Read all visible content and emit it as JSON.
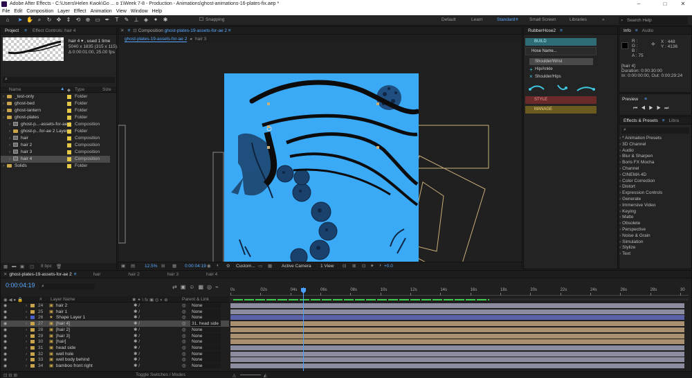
{
  "window": {
    "title": "Adobe After Effects - C:\\Users\\Helen Kwok\\Go ... o 1\\Week 7-8 - Production - Animations\\ghost-animations-16-plates-fix.aep *",
    "minimize": "–",
    "maximize": "□",
    "close": "✕"
  },
  "menu": [
    "File",
    "Edit",
    "Composition",
    "Layer",
    "Effect",
    "Animation",
    "View",
    "Window",
    "Help"
  ],
  "toolbar": {
    "snapping": "Snapping",
    "workspaces": [
      "Default",
      "Learn",
      "Standard",
      "Small Screen",
      "Libraries"
    ],
    "active_workspace": "Standard",
    "search_help": "Search Help"
  },
  "project": {
    "tabs": [
      "Project",
      "Effect Controls: hair 4"
    ],
    "item_name": "hair 4 ▾ , used 1 time",
    "item_dims": "5040 x 1835  (315 x 115)...",
    "item_time": "Δ 0:00:01:00, 25.00 fps",
    "columns": [
      "Name",
      "Type",
      "Size"
    ],
    "items": [
      {
        "name": "_test-only",
        "type": "Folder",
        "kind": "folder",
        "indent": 0,
        "color": "#e3c84a"
      },
      {
        "name": "ghost-bed",
        "type": "Folder",
        "kind": "folder",
        "indent": 0,
        "color": "#e3c84a"
      },
      {
        "name": "ghost-lantern",
        "type": "Folder",
        "kind": "folder",
        "indent": 0,
        "color": "#e3c84a"
      },
      {
        "name": "ghost-plates",
        "type": "Folder",
        "kind": "folder",
        "indent": 0,
        "color": "#e3c84a"
      },
      {
        "name": "ghost-p...-assets-for-ae 2",
        "type": "Composition",
        "kind": "comp",
        "indent": 1,
        "color": "#e3c84a"
      },
      {
        "name": "ghost-p...for-ae 2 Layers",
        "type": "Folder",
        "kind": "folder",
        "indent": 1,
        "color": "#e3c84a"
      },
      {
        "name": "hair",
        "type": "Composition",
        "kind": "comp",
        "indent": 1,
        "color": "#e3c84a"
      },
      {
        "name": "hair 2",
        "type": "Composition",
        "kind": "comp",
        "indent": 1,
        "color": "#e3c84a"
      },
      {
        "name": "hair 3",
        "type": "Composition",
        "kind": "comp",
        "indent": 1,
        "color": "#e3c84a"
      },
      {
        "name": "hair 4",
        "type": "Composition",
        "kind": "comp",
        "indent": 1,
        "color": "#e3c84a",
        "selected": true
      },
      {
        "name": "Solids",
        "type": "Folder",
        "kind": "folder",
        "indent": 0,
        "color": "#e3c84a"
      }
    ],
    "bpc": "8 bpc"
  },
  "composition": {
    "tab_label": "Composition",
    "tab_name": "ghost-plates-19-assets-for-ae 2",
    "sub_tabs": [
      "ghost-plates-19-assets-for-ae 2",
      "hair 3"
    ],
    "footer": {
      "zoom": "12.5%",
      "time": "0:00:04:19",
      "view": "Custom...",
      "camera": "Active Camera",
      "views": "1 View",
      "exposure": "+0.0"
    }
  },
  "rubberhose": {
    "title": "RubberHose2",
    "build": "BUILD",
    "hose_name": "Hose Name...",
    "presets": [
      "Shoulder/Wrist",
      "Hip/Ankle",
      "Shoulder/Hips"
    ],
    "style": "STYLE",
    "manage": "MANAGE"
  },
  "info": {
    "tabs": [
      "Info",
      "Audio"
    ],
    "r": "R :",
    "g": "G :",
    "b": "B :",
    "a": "A : 75",
    "x": "X : 448",
    "y": "Y : 4136",
    "layer": "[hair 4]",
    "duration": "Duration: 0:00:30:00",
    "inout": "In: 0:00:00:00, Out: 0:00:29:24"
  },
  "preview": {
    "title": "Preview"
  },
  "effects": {
    "tabs": [
      "Effects & Presets",
      "Libra"
    ],
    "items": [
      "* Animation Presets",
      "3D Channel",
      "Audio",
      "Blur & Sharpen",
      "Boris FX Mocha",
      "Channel",
      "CINEMA 4D",
      "Color Correction",
      "Distort",
      "Expression Controls",
      "Generate",
      "Immersive Video",
      "Keying",
      "Matte",
      "Obsolete",
      "Perspective",
      "Noise & Grain",
      "Simulation",
      "Stylize",
      "Text"
    ]
  },
  "timeline": {
    "tabs": [
      "ghost-plates-19-assets-for-ae 2",
      "hair",
      "hair 2",
      "hair 3",
      "hair 4"
    ],
    "time": "0:00:04:19",
    "columns": {
      "num": "#",
      "name": "Layer Name",
      "parent": "Parent & Link"
    },
    "ruler": [
      "0s",
      "02s",
      "04s",
      "06s",
      "08s",
      "10s",
      "12s",
      "14s",
      "16s",
      "18s",
      "20s",
      "22s",
      "24s",
      "26s",
      "28s",
      "30"
    ],
    "layers": [
      {
        "num": "24",
        "name": "hair 2",
        "chip": "#c9a44a",
        "parent": "None",
        "bar": "#8c8ca0"
      },
      {
        "num": "25",
        "name": "hair 1",
        "chip": "#c9a44a",
        "parent": "None",
        "bar": "#8c8ca0"
      },
      {
        "num": "26",
        "name": "Shape Layer 1",
        "chip": "#4a5fc9",
        "parent": "None",
        "bar": "#5c62a8"
      },
      {
        "num": "27",
        "name": "[hair 4]",
        "chip": "#c9a44a",
        "parent": "31. head side",
        "bar": "#a89070",
        "selected": true
      },
      {
        "num": "28",
        "name": "[hair 2]",
        "chip": "#c9a44a",
        "parent": "None",
        "bar": "#a89070"
      },
      {
        "num": "29",
        "name": "[hair 3]",
        "chip": "#c9a44a",
        "parent": "None",
        "bar": "#a89070"
      },
      {
        "num": "30",
        "name": "[hair]",
        "chip": "#c9a44a",
        "parent": "None",
        "bar": "#a89070"
      },
      {
        "num": "31",
        "name": "head side",
        "chip": "#c9a44a",
        "parent": "None",
        "bar": "#8c8ca0"
      },
      {
        "num": "32",
        "name": "well hole",
        "chip": "#c9a44a",
        "parent": "None",
        "bar": "#8c8ca0"
      },
      {
        "num": "33",
        "name": "well body behind",
        "chip": "#c9a44a",
        "parent": "None",
        "bar": "#8c8ca0"
      },
      {
        "num": "34",
        "name": "bamboo front right",
        "chip": "#c9a44a",
        "parent": "None",
        "bar": "#8c8ca0"
      }
    ],
    "footer": "Toggle Switches / Modes"
  }
}
